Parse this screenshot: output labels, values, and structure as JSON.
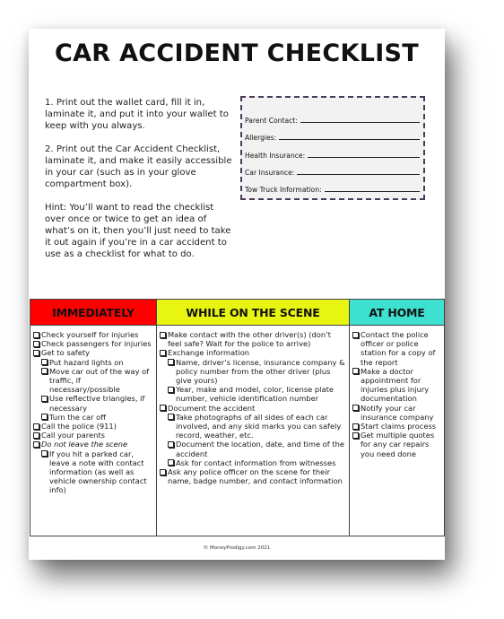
{
  "document": {
    "title": "CAR ACCIDENT CHECKLIST",
    "instructions": [
      "1. Print out the wallet card, fill it in, laminate it, and put it into your wallet to keep with you always.",
      "2. Print out the Car Accident Checklist, laminate it, and make it easily accessible in your car (such as in your glove compartment box).",
      "Hint: You’ll want to read the checklist over once or twice to get an idea of what’s on it, then you’ll just need to take it out again if you’re in a car accident to use as a checklist for what to do."
    ],
    "wallet_card": {
      "border_color": "#4a3a5a",
      "fields": [
        {
          "label": "Parent Contact:",
          "value": ""
        },
        {
          "label": "Allergies:",
          "value": ""
        },
        {
          "label": "Health Insurance:",
          "value": ""
        },
        {
          "label": "Car Insurance:",
          "value": ""
        },
        {
          "label": "Tow Truck Information:",
          "value": ""
        }
      ]
    },
    "checklist": {
      "columns": [
        {
          "header": "IMMEDIATELY",
          "color": "#ff0000",
          "items": [
            {
              "text": "Check yourself for injuries",
              "level": 0
            },
            {
              "text": "Check passengers for injuries",
              "level": 0
            },
            {
              "text": "Get to safety",
              "level": 0
            },
            {
              "text": "Put hazard lights on",
              "level": 1
            },
            {
              "text": "Move car out of the way of traffic, if necessary/possible",
              "level": 1
            },
            {
              "text": "Use reflective triangles, if necessary",
              "level": 1
            },
            {
              "text": "Turn the car off",
              "level": 1
            },
            {
              "text": "Call the police (911)",
              "level": 0
            },
            {
              "text": "Call your parents",
              "level": 0
            },
            {
              "text": "Do not leave the scene",
              "level": 0,
              "italic": true
            },
            {
              "text": "If you hit a parked car, leave a note with contact information (as well as vehicle ownership contact info)",
              "level": 1
            }
          ]
        },
        {
          "header": "WHILE ON THE SCENE",
          "color": "#e8f510",
          "items": [
            {
              "text": "Make contact with the other driver(s) (don’t feel safe? Wait for the police to arrive)",
              "level": 0
            },
            {
              "text": "Exchange information",
              "level": 0
            },
            {
              "text": "Name, driver’s license, insurance company & policy number from the other driver (plus give yours)",
              "level": 1
            },
            {
              "text": "Year, make and model, color, license plate number, vehicle identification number",
              "level": 1
            },
            {
              "text": "Document the accident",
              "level": 0
            },
            {
              "text": "Take photographs of all sides of each car involved, and any skid marks you can safely record, weather, etc.",
              "level": 1
            },
            {
              "text": "Document the location, date, and time of the accident",
              "level": 1
            },
            {
              "text": "Ask for contact information from witnesses",
              "level": 1
            },
            {
              "text": "Ask any police officer on the scene for their name, badge number, and contact information",
              "level": 0
            }
          ]
        },
        {
          "header": "AT HOME",
          "color": "#3ee0d0",
          "items": [
            {
              "text": "Contact the police officer or police station for a copy of the report",
              "level": 0
            },
            {
              "text": "Make a doctor appointment for injuries plus injury documentation",
              "level": 0
            },
            {
              "text": "Notify your car insurance company",
              "level": 0
            },
            {
              "text": "Start claims process",
              "level": 0
            },
            {
              "text": "Get multiple quotes for any car repairs you need done",
              "level": 0
            }
          ]
        }
      ]
    },
    "footer": "© MoneyProdigy.com 2021"
  }
}
